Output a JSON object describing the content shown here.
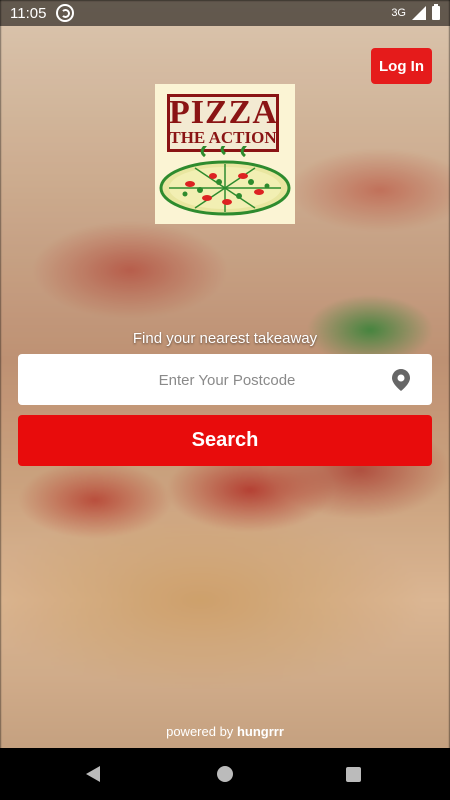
{
  "status_bar": {
    "time": "11:05",
    "network": "3G"
  },
  "header": {
    "login_label": "Log In"
  },
  "logo": {
    "line1": "PIZZA",
    "line2": "THE ACTION"
  },
  "search": {
    "prompt": "Find your nearest takeaway",
    "placeholder": "Enter Your Postcode",
    "button_label": "Search"
  },
  "footer": {
    "powered_prefix": "powered by",
    "powered_brand": "hungrrr"
  },
  "colors": {
    "accent": "#e80c0c",
    "logo_red": "#8a1414",
    "logo_green": "#2e8b2e"
  }
}
